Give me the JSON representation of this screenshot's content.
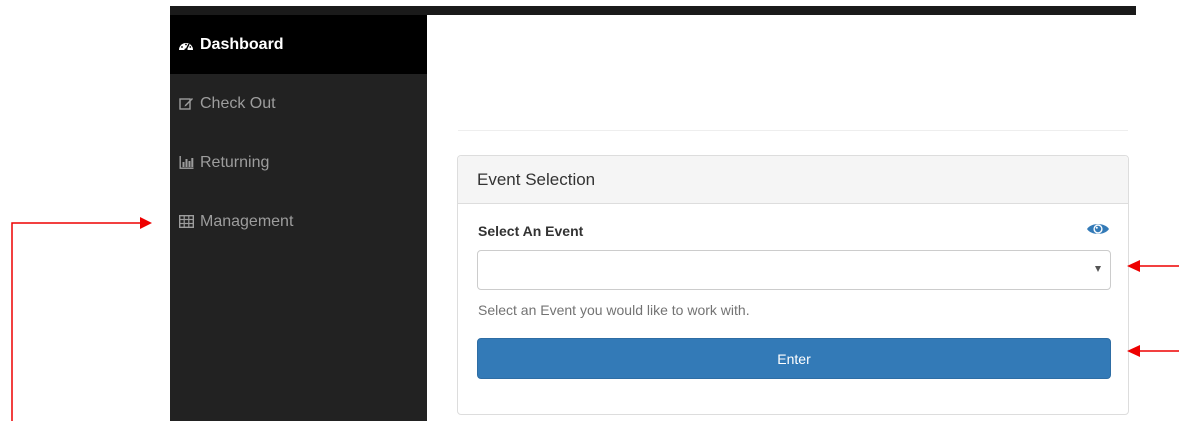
{
  "sidebar": {
    "items": [
      {
        "label": "Dashboard",
        "icon": "dashboard-icon",
        "active": true
      },
      {
        "label": "Check Out",
        "icon": "edit-icon",
        "active": false
      },
      {
        "label": "Returning",
        "icon": "bar-chart-icon",
        "active": false
      },
      {
        "label": "Management",
        "icon": "table-icon",
        "active": false
      }
    ]
  },
  "panel": {
    "heading": "Event Selection",
    "field_label": "Select An Event",
    "select_value": "",
    "help_text": "Select an Event you would like to work with.",
    "enter_label": "Enter"
  },
  "colors": {
    "sidebar_bg": "#222222",
    "active_bg": "#000000",
    "primary_button": "#337ab7",
    "eye_icon": "#337ab7",
    "annotation_arrow": "#ee0000"
  }
}
